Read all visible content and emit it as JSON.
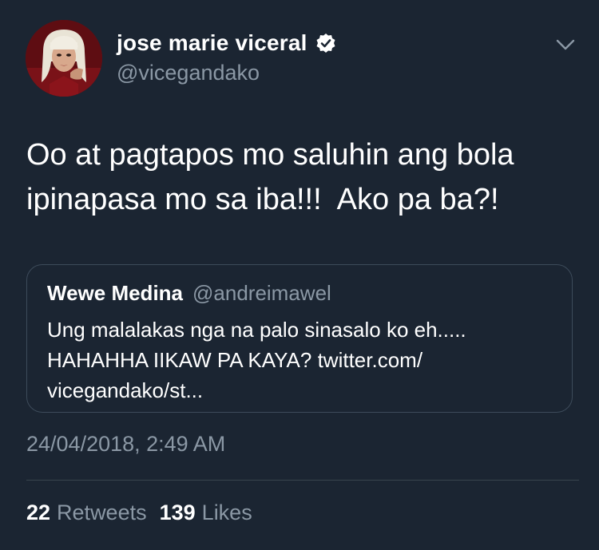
{
  "author": {
    "display_name": "jose marie viceral",
    "handle": "@vicegandako",
    "verified": true
  },
  "tweet": {
    "text": "Oo at pagtapos mo saluhin ang bola\nipinapasa mo sa iba!!!  Ako pa ba?!",
    "timestamp": "24/04/2018, 2:49 AM"
  },
  "quoted_tweet": {
    "display_name": "Wewe Medina",
    "handle": "@andreimawel",
    "text": "Ung malalakas nga na palo sinasalo ko eh..... HAHAHHA IIKAW PA KAYA? twitter.com/ vicegandako/st..."
  },
  "stats": {
    "retweets_count": "22",
    "retweets_label": "Retweets",
    "likes_count": "139",
    "likes_label": "Likes"
  },
  "icons": {
    "verified": "verified-badge-icon",
    "menu": "chevron-down-icon"
  },
  "colors": {
    "background": "#1b2532",
    "secondary_text": "#8b98a5",
    "primary_text": "#ffffff"
  }
}
